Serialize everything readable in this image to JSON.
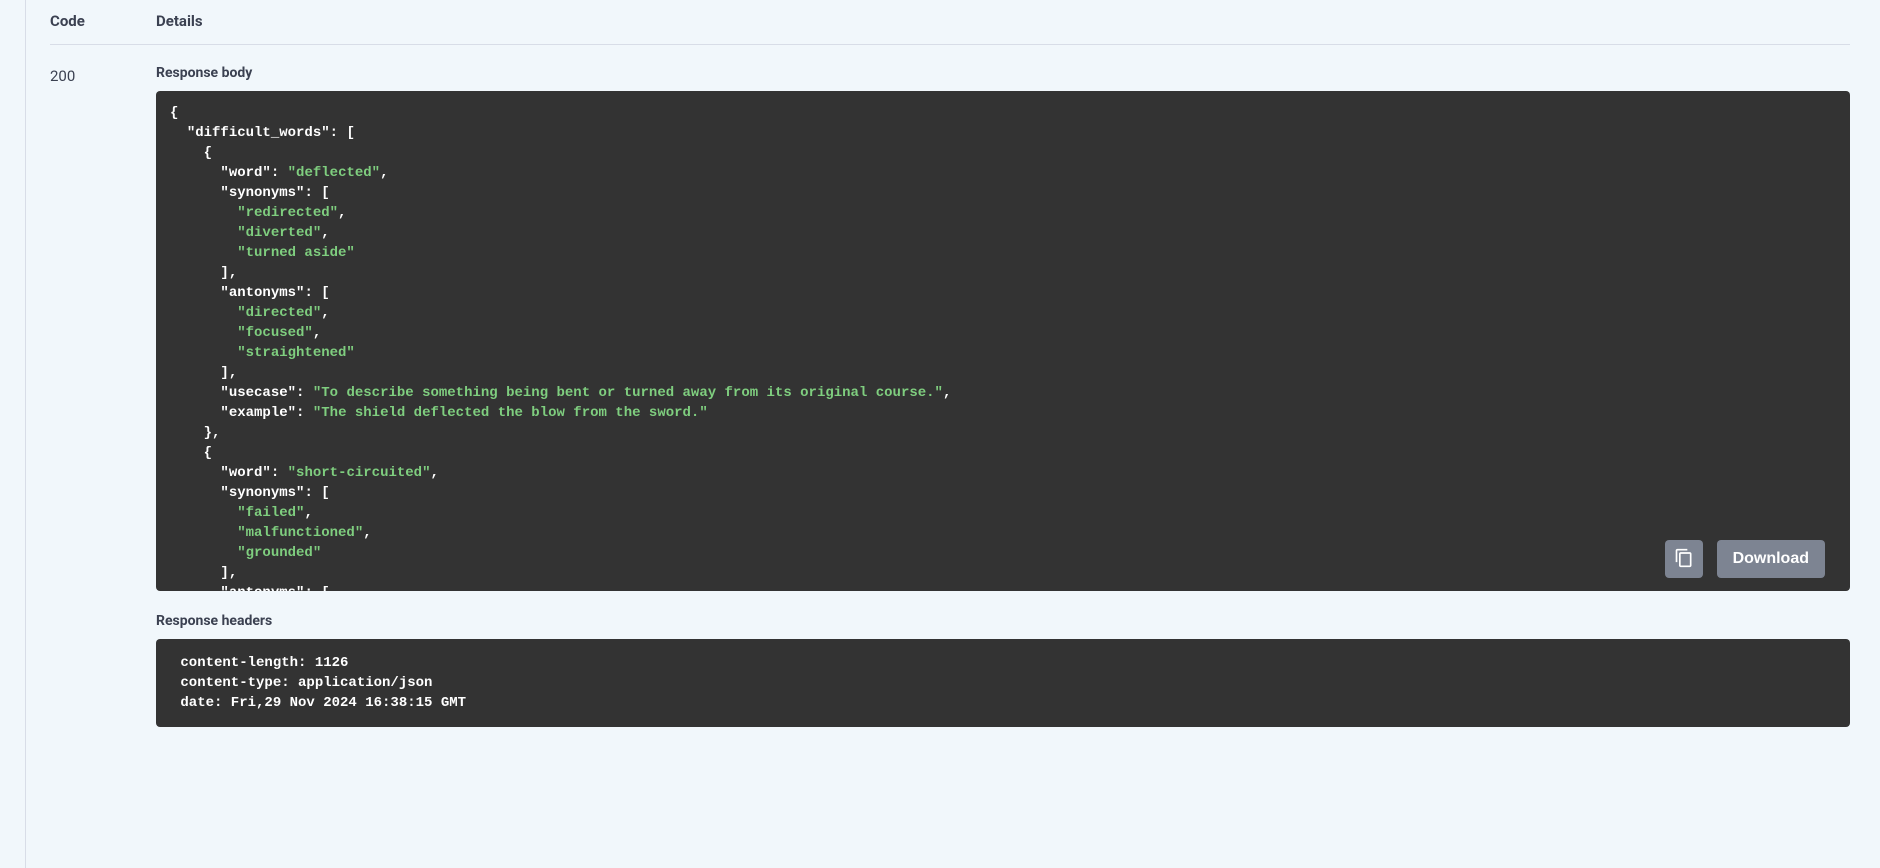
{
  "headers": {
    "code": "Code",
    "details": "Details"
  },
  "response": {
    "code": "200",
    "body_label": "Response body",
    "headers_label": "Response headers"
  },
  "actions": {
    "download": "Download"
  },
  "response_body_json": {
    "difficult_words": [
      {
        "word": "deflected",
        "synonyms": [
          "redirected",
          "diverted",
          "turned aside"
        ],
        "antonyms": [
          "directed",
          "focused",
          "straightened"
        ],
        "usecase": "To describe something being bent or turned away from its original course.",
        "example": "The shield deflected the blow from the sword."
      },
      {
        "word": "short-circuited",
        "synonyms": [
          "failed",
          "malfunctioned",
          "grounded"
        ],
        "antonyms_partial": true
      }
    ]
  },
  "response_headers_text": " content-length: 1126 \n content-type: application/json \n date: Fri,29 Nov 2024 16:38:15 GMT ",
  "body_lines": [
    {
      "indent": 0,
      "tokens": [
        {
          "t": "punct",
          "v": "{"
        }
      ]
    },
    {
      "indent": 1,
      "tokens": [
        {
          "t": "key",
          "v": "\"difficult_words\""
        },
        {
          "t": "punct",
          "v": ": ["
        }
      ]
    },
    {
      "indent": 2,
      "tokens": [
        {
          "t": "punct",
          "v": "{"
        }
      ]
    },
    {
      "indent": 3,
      "tokens": [
        {
          "t": "key",
          "v": "\"word\""
        },
        {
          "t": "punct",
          "v": ": "
        },
        {
          "t": "string",
          "v": "\"deflected\""
        },
        {
          "t": "punct",
          "v": ","
        }
      ]
    },
    {
      "indent": 3,
      "tokens": [
        {
          "t": "key",
          "v": "\"synonyms\""
        },
        {
          "t": "punct",
          "v": ": ["
        }
      ]
    },
    {
      "indent": 4,
      "tokens": [
        {
          "t": "string",
          "v": "\"redirected\""
        },
        {
          "t": "punct",
          "v": ","
        }
      ]
    },
    {
      "indent": 4,
      "tokens": [
        {
          "t": "string",
          "v": "\"diverted\""
        },
        {
          "t": "punct",
          "v": ","
        }
      ]
    },
    {
      "indent": 4,
      "tokens": [
        {
          "t": "string",
          "v": "\"turned aside\""
        }
      ]
    },
    {
      "indent": 3,
      "tokens": [
        {
          "t": "punct",
          "v": "],"
        }
      ]
    },
    {
      "indent": 3,
      "tokens": [
        {
          "t": "key",
          "v": "\"antonyms\""
        },
        {
          "t": "punct",
          "v": ": ["
        }
      ]
    },
    {
      "indent": 4,
      "tokens": [
        {
          "t": "string",
          "v": "\"directed\""
        },
        {
          "t": "punct",
          "v": ","
        }
      ]
    },
    {
      "indent": 4,
      "tokens": [
        {
          "t": "string",
          "v": "\"focused\""
        },
        {
          "t": "punct",
          "v": ","
        }
      ]
    },
    {
      "indent": 4,
      "tokens": [
        {
          "t": "string",
          "v": "\"straightened\""
        }
      ]
    },
    {
      "indent": 3,
      "tokens": [
        {
          "t": "punct",
          "v": "],"
        }
      ]
    },
    {
      "indent": 3,
      "tokens": [
        {
          "t": "key",
          "v": "\"usecase\""
        },
        {
          "t": "punct",
          "v": ": "
        },
        {
          "t": "string",
          "v": "\"To describe something being bent or turned away from its original course.\""
        },
        {
          "t": "punct",
          "v": ","
        }
      ]
    },
    {
      "indent": 3,
      "tokens": [
        {
          "t": "key",
          "v": "\"example\""
        },
        {
          "t": "punct",
          "v": ": "
        },
        {
          "t": "string",
          "v": "\"The shield deflected the blow from the sword.\""
        }
      ]
    },
    {
      "indent": 2,
      "tokens": [
        {
          "t": "punct",
          "v": "},"
        }
      ]
    },
    {
      "indent": 2,
      "tokens": [
        {
          "t": "punct",
          "v": "{"
        }
      ]
    },
    {
      "indent": 3,
      "tokens": [
        {
          "t": "key",
          "v": "\"word\""
        },
        {
          "t": "punct",
          "v": ": "
        },
        {
          "t": "string",
          "v": "\"short-circuited\""
        },
        {
          "t": "punct",
          "v": ","
        }
      ]
    },
    {
      "indent": 3,
      "tokens": [
        {
          "t": "key",
          "v": "\"synonyms\""
        },
        {
          "t": "punct",
          "v": ": ["
        }
      ]
    },
    {
      "indent": 4,
      "tokens": [
        {
          "t": "string",
          "v": "\"failed\""
        },
        {
          "t": "punct",
          "v": ","
        }
      ]
    },
    {
      "indent": 4,
      "tokens": [
        {
          "t": "string",
          "v": "\"malfunctioned\""
        },
        {
          "t": "punct",
          "v": ","
        }
      ]
    },
    {
      "indent": 4,
      "tokens": [
        {
          "t": "string",
          "v": "\"grounded\""
        }
      ]
    },
    {
      "indent": 3,
      "tokens": [
        {
          "t": "punct",
          "v": "],"
        }
      ]
    },
    {
      "indent": 3,
      "tokens": [
        {
          "t": "key",
          "v": "\"antonyms\""
        },
        {
          "t": "punct",
          "v": ": ["
        }
      ]
    }
  ]
}
